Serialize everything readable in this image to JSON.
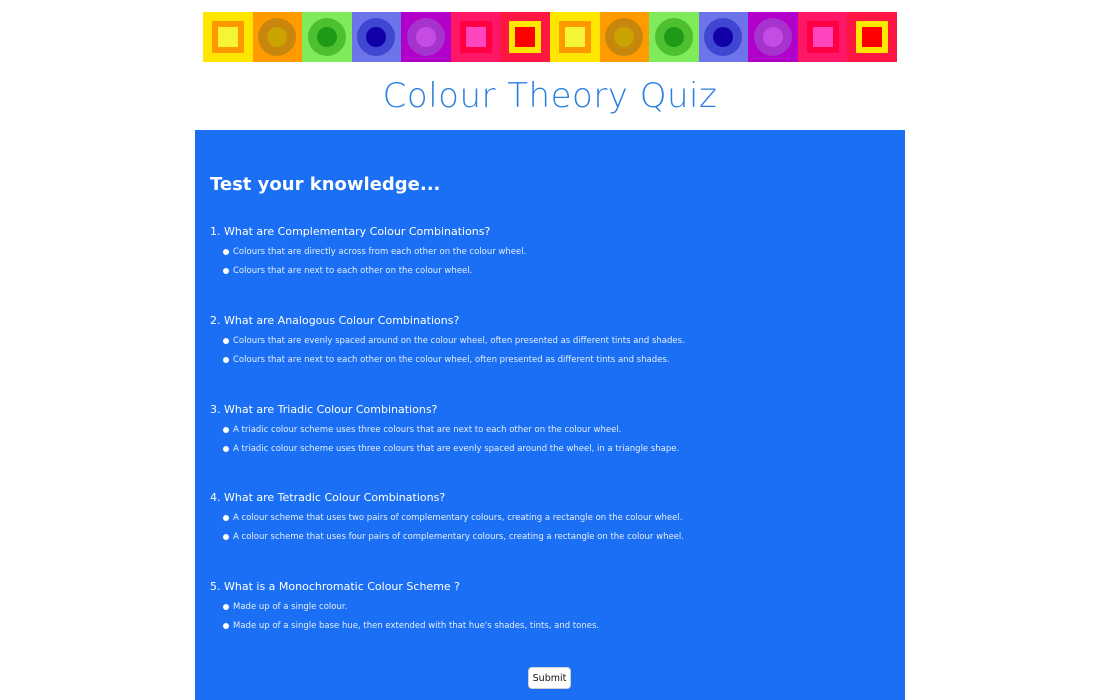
{
  "header": {
    "title": "Colour Theory Quiz",
    "banner_tiles": [
      {
        "outer": "#ffe600",
        "inner": "#f5f535",
        "shape": "square",
        "ring": "#ff9900"
      },
      {
        "outer": "#ff9a00",
        "inner": "#c9a300",
        "shape": "circle",
        "ring": "#c8860d"
      },
      {
        "outer": "#7fea5a",
        "inner": "#1f9a18",
        "shape": "circle",
        "ring": "#4cc02f"
      },
      {
        "outer": "#6d73e8",
        "inner": "#1100a8",
        "shape": "circle",
        "ring": "#3f46d2"
      },
      {
        "outer": "#b100c9",
        "inner": "#c44be3",
        "shape": "circle",
        "ring": "#a733cf"
      },
      {
        "outer": "#ff1767",
        "inner": "#ff45bd",
        "shape": "square",
        "ring": "#ff0044"
      },
      {
        "outer": "#ff1744",
        "inner": "#ff0000",
        "shape": "square",
        "ring": "#ffe600"
      },
      {
        "outer": "#ffe600",
        "inner": "#f5f535",
        "shape": "square",
        "ring": "#ff9900"
      },
      {
        "outer": "#ff9a00",
        "inner": "#c9a300",
        "shape": "circle",
        "ring": "#c8860d"
      },
      {
        "outer": "#7fea5a",
        "inner": "#1f9a18",
        "shape": "circle",
        "ring": "#4cc02f"
      },
      {
        "outer": "#6d73e8",
        "inner": "#1100a8",
        "shape": "circle",
        "ring": "#3f46d2"
      },
      {
        "outer": "#b100c9",
        "inner": "#c44be3",
        "shape": "circle",
        "ring": "#a733cf"
      },
      {
        "outer": "#ff1767",
        "inner": "#ff45bd",
        "shape": "square",
        "ring": "#ff0044"
      },
      {
        "outer": "#ff1744",
        "inner": "#ff0000",
        "shape": "square",
        "ring": "#ffe600"
      }
    ]
  },
  "colors": {
    "title": "#2b7fe0",
    "panel": "#1b6ff5"
  },
  "quiz": {
    "heading": "Test your knowledge...",
    "questions": [
      {
        "text": "1. What are Complementary Colour Combinations?",
        "options": [
          "Colours that are directly across from each other on the colour wheel.",
          "Colours that are next to each other on the colour wheel."
        ]
      },
      {
        "text": "2. What are Analogous Colour Combinations?",
        "options": [
          "Colours that are evenly spaced around on the colour wheel, often presented as different tints and shades.",
          "Colours that are next to each other on the colour wheel, often presented as different tints and shades."
        ]
      },
      {
        "text": "3. What are Triadic Colour Combinations?",
        "options": [
          "A triadic colour scheme uses three colours that are next to each other on the colour wheel.",
          "A triadic colour scheme uses three colours that are evenly spaced around the wheel, in a triangle shape."
        ]
      },
      {
        "text": "4. What are Tetradic Colour Combinations?",
        "options": [
          "A colour scheme that uses two pairs of complementary colours, creating a rectangle on the colour wheel.",
          "A colour scheme that uses four pairs of complementary colours, creating a rectangle on the colour wheel."
        ]
      },
      {
        "text": "5. What is a Monochromatic Colour Scheme ?",
        "options": [
          "Made up of a single colour.",
          "Made up of a single base hue, then extended with that hue's shades, tints, and tones."
        ]
      }
    ],
    "submit_label": "Submit"
  }
}
